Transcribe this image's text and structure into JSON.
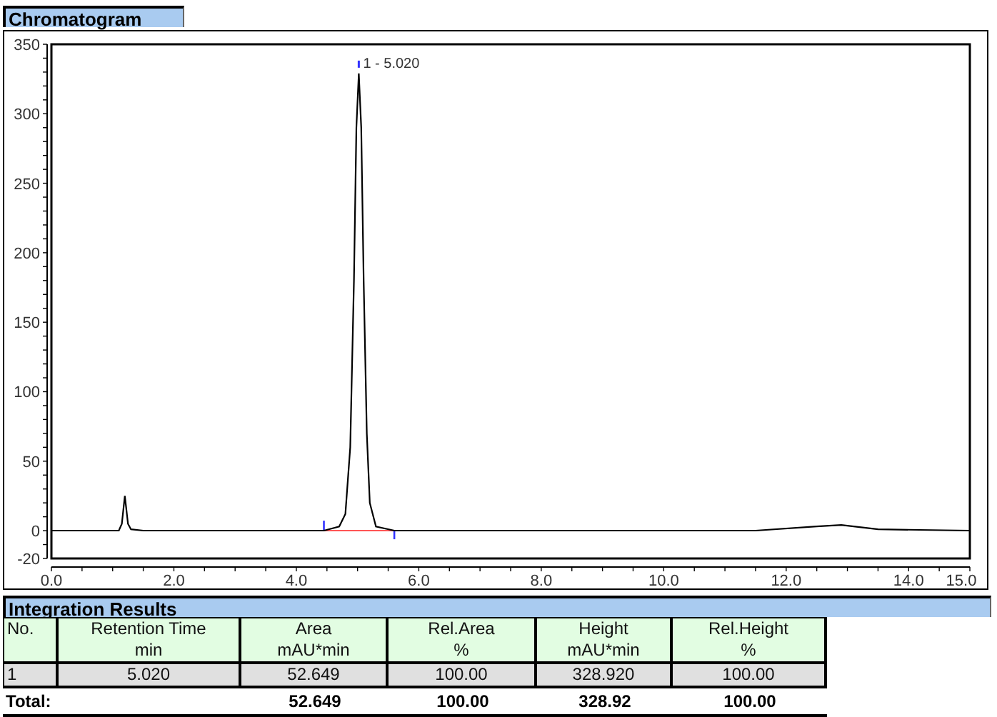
{
  "chromatogram": {
    "title": "Chromatogram",
    "chart_data": {
      "type": "line",
      "x": [
        0,
        1.1,
        1.15,
        1.2,
        1.25,
        1.3,
        1.5,
        4.45,
        4.7,
        4.8,
        4.88,
        4.94,
        4.98,
        5.02,
        5.06,
        5.1,
        5.15,
        5.2,
        5.3,
        5.6,
        11.5,
        12.5,
        12.9,
        13.5,
        15
      ],
      "series": [
        {
          "color": "#ff5555",
          "values": [
            null,
            null,
            null,
            null,
            null,
            null,
            null,
            0,
            0,
            0,
            0,
            0,
            0,
            0,
            0,
            0,
            0,
            0,
            0,
            0,
            null,
            null,
            null,
            null,
            null
          ]
        },
        {
          "color": "#000000",
          "values": [
            0,
            0,
            5,
            25,
            5,
            1,
            0,
            0,
            3,
            12,
            60,
            180,
            290,
            329,
            290,
            180,
            70,
            20,
            3,
            0,
            0,
            3,
            4,
            1,
            0
          ]
        }
      ],
      "xlim": [
        0,
        15
      ],
      "ylim": [
        -20,
        350
      ],
      "xticks": [
        {
          "value": 0,
          "label": "0.0"
        },
        {
          "value": 2,
          "label": "2.0"
        },
        {
          "value": 4,
          "label": "4.0"
        },
        {
          "value": 6,
          "label": "6.0"
        },
        {
          "value": 8,
          "label": "8.0"
        },
        {
          "value": 10,
          "label": "10.0"
        },
        {
          "value": 12,
          "label": "12.0"
        },
        {
          "value": 14,
          "label": "14.0"
        },
        {
          "value": 15,
          "label": "15.0"
        }
      ],
      "yticks": [
        -20,
        0,
        50,
        100,
        150,
        200,
        250,
        300,
        350
      ],
      "annotations": [
        {
          "x": 5.02,
          "y": 329,
          "text": "1 - 5.020"
        }
      ]
    }
  },
  "integration": {
    "title": "Integration Results",
    "columns": [
      {
        "title": "No."
      },
      {
        "title": "Retention Time",
        "unit": "min"
      },
      {
        "title": "Area",
        "unit": "mAU*min"
      },
      {
        "title": "Rel.Area",
        "unit": "%"
      },
      {
        "title": "Height",
        "unit": "mAU*min"
      },
      {
        "title": "Rel.Height",
        "unit": "%"
      }
    ],
    "rows": [
      [
        "1",
        "5.020",
        "52.649",
        "100.00",
        "328.920",
        "100.00"
      ]
    ],
    "total": {
      "label": "Total:",
      "values": [
        "52.649",
        "100.00",
        "328.92",
        "100.00"
      ]
    }
  }
}
